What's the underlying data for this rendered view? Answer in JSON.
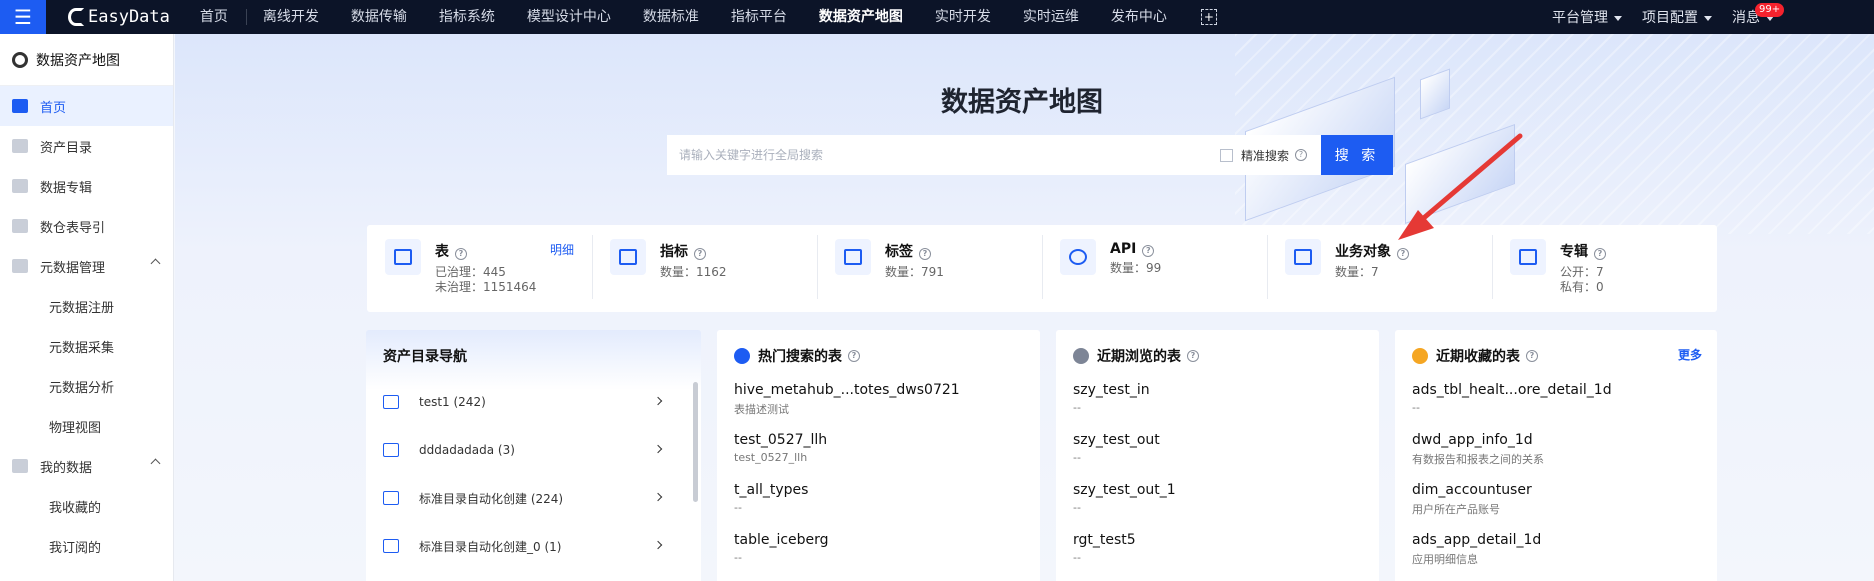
{
  "topnav": {
    "logo": "EasyData",
    "items": [
      "首页",
      "离线开发",
      "数据传输",
      "指标系统",
      "模型设计中心",
      "数据标准",
      "指标平台",
      "数据资产地图",
      "实时开发",
      "实时运维",
      "发布中心"
    ],
    "active": "数据资产地图",
    "right": {
      "platform": "平台管理",
      "project": "项目配置",
      "messages": "消息",
      "badge": "99+"
    }
  },
  "sidebar": {
    "title": "数据资产地图",
    "items": [
      {
        "label": "首页",
        "active": true
      },
      {
        "label": "资产目录"
      },
      {
        "label": "数据专辑"
      },
      {
        "label": "数仓表导引"
      },
      {
        "label": "元数据管理",
        "group": true
      },
      {
        "label": "元数据注册",
        "sub": true
      },
      {
        "label": "元数据采集",
        "sub": true
      },
      {
        "label": "元数据分析",
        "sub": true
      },
      {
        "label": "物理视图",
        "sub": true
      },
      {
        "label": "我的数据",
        "group": true
      },
      {
        "label": "我收藏的",
        "sub": true
      },
      {
        "label": "我订阅的",
        "sub": true
      }
    ]
  },
  "hero": {
    "title": "数据资产地图",
    "search_placeholder": "请输入关键字进行全局搜索",
    "exact_label": "精准搜索",
    "search_button": "搜 索"
  },
  "stats": [
    {
      "name": "表",
      "lines": [
        "已治理：445",
        "未治理：1151464"
      ],
      "link": "明细"
    },
    {
      "name": "指标",
      "lines": [
        "数量：1162"
      ]
    },
    {
      "name": "标签",
      "lines": [
        "数量：791"
      ]
    },
    {
      "name": "API",
      "lines": [
        "数量：99"
      ]
    },
    {
      "name": "业务对象",
      "lines": [
        "数量：7"
      ]
    },
    {
      "name": "专辑",
      "lines": [
        "公开：7",
        "私有：0"
      ]
    }
  ],
  "catalog_nav": {
    "title": "资产目录导航",
    "items": [
      "test1 (242)",
      "dddadadada (3)",
      "标准目录自动化创建 (224)",
      "标准目录自动化创建_0 (1)"
    ]
  },
  "hot_tables": {
    "title": "热门搜索的表",
    "items": [
      {
        "name": "hive_metahub_...totes_dws0721",
        "desc": "表描述测试"
      },
      {
        "name": "test_0527_llh",
        "desc": "test_0527_llh"
      },
      {
        "name": "t_all_types",
        "desc": "--"
      },
      {
        "name": "table_iceberg",
        "desc": "--"
      }
    ]
  },
  "recent_tables": {
    "title": "近期浏览的表",
    "items": [
      {
        "name": "szy_test_in",
        "desc": "--"
      },
      {
        "name": "szy_test_out",
        "desc": "--"
      },
      {
        "name": "szy_test_out_1",
        "desc": "--"
      },
      {
        "name": "rgt_test5",
        "desc": "--"
      }
    ]
  },
  "fav_tables": {
    "title": "近期收藏的表",
    "more": "更多",
    "items": [
      {
        "name": "ads_tbl_healt...ore_detail_1d",
        "desc": "--"
      },
      {
        "name": "dwd_app_info_1d",
        "desc": "有数报告和报表之间的关系"
      },
      {
        "name": "dim_accountuser",
        "desc": "用户所在产品账号"
      },
      {
        "name": "ads_app_detail_1d",
        "desc": "应用明细信息"
      }
    ]
  },
  "colors": {
    "primary": "#1d5cf2",
    "topbar": "#0c1428",
    "annotation": "#e53935"
  }
}
